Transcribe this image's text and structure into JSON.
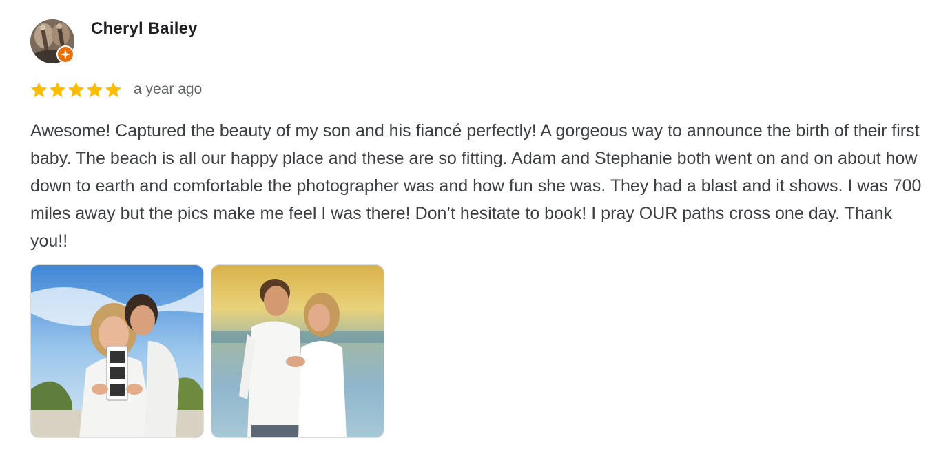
{
  "review": {
    "reviewer_name": "Cheryl Bailey",
    "avatar": {
      "icon": "avatar-photo",
      "badge_icon": "local-guide-star-icon",
      "badge_color": "#e8710a"
    },
    "rating": {
      "value": 5,
      "max": 5,
      "star_color": "#fbbc04"
    },
    "timestamp": "a year ago",
    "text": "Awesome! Captured the beauty of my son and his fiancé perfectly! A gorgeous way to announce the birth of their first baby. The beach is all our happy place and these are so fitting. Adam and Stephanie both went on and on about how down to earth and comfortable the photographer was and how fun she was. They had a blast and it shows. I was 700 miles away but the pics make me feel I was there! Don’t hesitate to book! I pray OUR paths cross one day. Thank you!!",
    "photos": [
      {
        "icon": "review-photo"
      },
      {
        "icon": "review-photo"
      }
    ]
  }
}
